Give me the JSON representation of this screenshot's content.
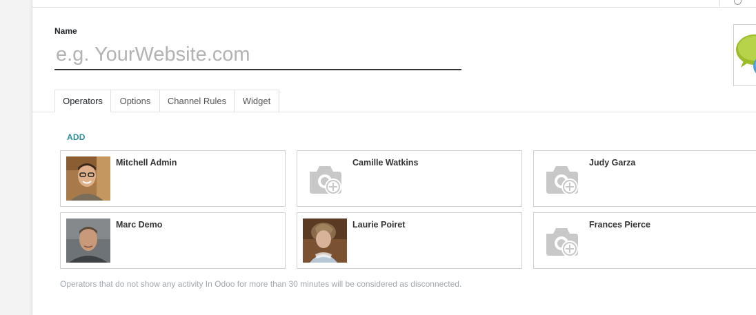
{
  "form": {
    "name_label": "Name",
    "name_placeholder": "e.g. YourWebsite.com",
    "name_value": ""
  },
  "tabs": [
    {
      "label": "Operators",
      "active": true
    },
    {
      "label": "Options",
      "active": false
    },
    {
      "label": "Channel Rules",
      "active": false
    },
    {
      "label": "Widget",
      "active": false
    }
  ],
  "operators": {
    "add_label": "ADD",
    "items": [
      {
        "name": "Mitchell Admin",
        "photo": "photo"
      },
      {
        "name": "Camille Watkins",
        "photo": "camera-placeholder-icon"
      },
      {
        "name": "Judy Garza",
        "photo": "camera-placeholder-icon"
      },
      {
        "name": "Marc Demo",
        "photo": "photo"
      },
      {
        "name": "Laurie Poiret",
        "photo": "photo"
      },
      {
        "name": "Frances Pierce",
        "photo": "camera-placeholder-icon"
      }
    ],
    "help_text": "Operators that do not show any activity In Odoo for more than 30 minutes will be considered as disconnected."
  },
  "colors": {
    "accent_link": "#2e8f9e",
    "placeholder_icon": "#c8c8c8"
  }
}
